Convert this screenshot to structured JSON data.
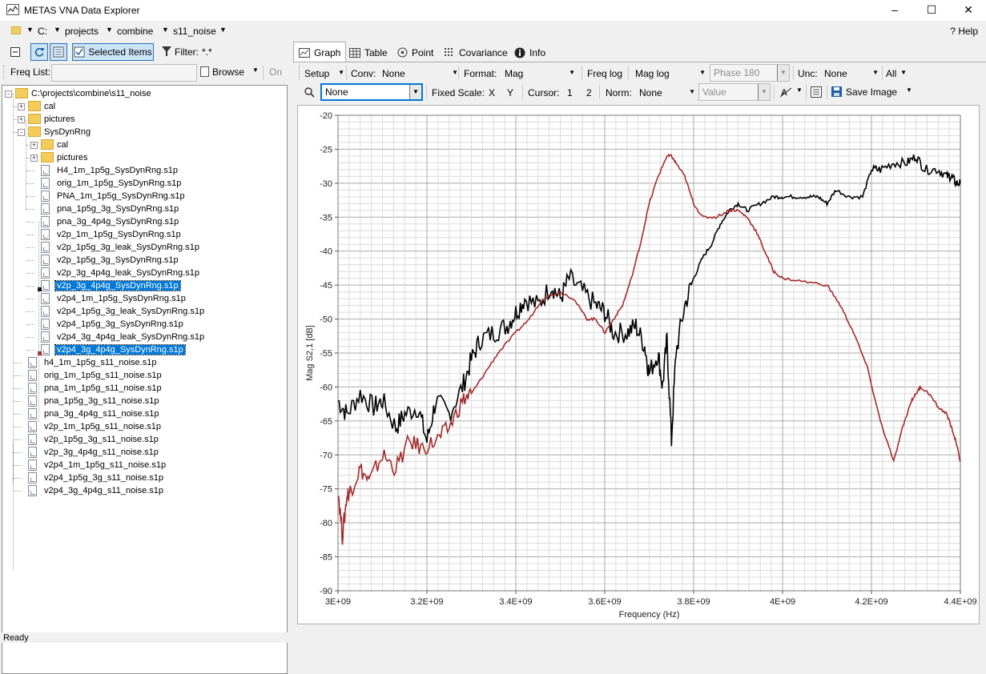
{
  "window": {
    "title": "METAS VNA Data Explorer",
    "minimize": "–",
    "maximize": "☐",
    "close": "✕"
  },
  "address": {
    "drive": "C:",
    "crumbs": [
      "projects",
      "combine",
      "s11_noise"
    ],
    "help": "Help",
    "help_prefix": "?"
  },
  "left_toolbar": {
    "selected_items": "Selected Items",
    "filter_label": "Filter:",
    "filter_value": "*.*"
  },
  "freq_list": {
    "label": "Freq List:",
    "browse": "Browse",
    "on": "On"
  },
  "tree": {
    "root": "C:\\projects\\combine\\s11_noise",
    "items": [
      "cal",
      "pictures",
      "SysDynRng",
      "cal",
      "pictures",
      "H4_1m_1p5g_SysDynRng.s1p",
      "orig_1m_1p5g_SysDynRng.s1p",
      "PNA_1m_1p5g_SysDynRng.s1p",
      "pna_1p5g_3g_SysDynRng.s1p",
      "pna_3g_4p4g_SysDynRng.s1p",
      "v2p_1m_1p5g_SysDynRng.s1p",
      "v2p_1p5g_3g_leak_SysDynRng.s1p",
      "v2p_1p5g_3g_SysDynRng.s1p",
      "v2p_3g_4p4g_leak_SysDynRng.s1p",
      "v2p_3g_4p4g_SysDynRng.s1p",
      "v2p4_1m_1p5g_SysDynRng.s1p",
      "v2p4_1p5g_3g_leak_SysDynRng.s1p",
      "v2p4_1p5g_3g_SysDynRng.s1p",
      "v2p4_3g_4p4g_leak_SysDynRng.s1p",
      "v2p4_3g_4p4g_SysDynRng.s1p",
      "h4_1m_1p5g_s11_noise.s1p",
      "orig_1m_1p5g_s11_noise.s1p",
      "pna_1m_1p5g_s11_noise.s1p",
      "pna_1p5g_3g_s11_noise.s1p",
      "pna_3g_4p4g_s11_noise.s1p",
      "v2p_1m_1p5g_s11_noise.s1p",
      "v2p_1p5g_3g_s11_noise.s1p",
      "v2p_3g_4p4g_s11_noise.s1p",
      "v2p4_1m_1p5g_s11_noise.s1p",
      "v2p4_1p5g_3g_s11_noise.s1p",
      "v2p4_3g_4p4g_s11_noise.s1p"
    ],
    "selected_colors": [
      "#000000",
      "#a52a2a"
    ]
  },
  "tabs": [
    "Graph",
    "Table",
    "Point",
    "Covariance",
    "Info"
  ],
  "options_row1": {
    "setup": "Setup",
    "conv_label": "Conv:",
    "conv_value": "None",
    "format_label": "Format:",
    "format_value": "Mag",
    "freq_log": "Freq log",
    "mag_log": "Mag log",
    "phase": "Phase 180",
    "unc_label": "Unc:",
    "unc_value": "None",
    "all": "All"
  },
  "options_row2": {
    "search_value": "None",
    "fixed_scale": "Fixed Scale:",
    "x": "X",
    "y": "Y",
    "cursor_label": "Cursor:",
    "c1": "1",
    "c2": "2",
    "norm_label": "Norm:",
    "norm_value": "None",
    "value_placeholder": "Value",
    "save_image": "Save Image"
  },
  "status": "Ready",
  "chart_data": {
    "type": "line",
    "xlabel": "Frequency (Hz)",
    "ylabel": "Mag S2,1 [dB]",
    "xlim": [
      3000000000,
      4400000000
    ],
    "ylim": [
      -90,
      -20
    ],
    "x_ticks": [
      "3E+09",
      "3.2E+09",
      "3.4E+09",
      "3.6E+09",
      "3.8E+09",
      "4E+09",
      "4.2E+09",
      "4.4E+09"
    ],
    "y_ticks": [
      "-20",
      "-25",
      "-30",
      "-35",
      "-40",
      "-45",
      "-50",
      "-55",
      "-60",
      "-65",
      "-70",
      "-75",
      "-80",
      "-85",
      "-90"
    ],
    "grid": true,
    "series": [
      {
        "color": "#000000",
        "x": [
          3.0,
          3.02,
          3.05,
          3.08,
          3.1,
          3.13,
          3.15,
          3.18,
          3.2,
          3.22,
          3.25,
          3.28,
          3.3,
          3.32,
          3.35,
          3.38,
          3.4,
          3.42,
          3.45,
          3.48,
          3.5,
          3.52,
          3.55,
          3.58,
          3.6,
          3.62,
          3.65,
          3.67,
          3.69,
          3.7,
          3.72,
          3.73,
          3.74,
          3.75,
          3.76,
          3.78,
          3.8,
          3.82,
          3.84,
          3.86,
          3.88,
          3.9,
          3.92,
          3.95,
          3.98,
          4.0,
          4.03,
          4.06,
          4.08,
          4.1,
          4.12,
          4.15,
          4.18,
          4.2,
          4.22,
          4.25,
          4.28,
          4.3,
          4.32,
          4.35,
          4.37,
          4.38,
          4.39,
          4.4
        ],
        "y": [
          -62,
          -64,
          -61,
          -63,
          -62,
          -66,
          -64,
          -63,
          -68,
          -62,
          -64,
          -60,
          -56,
          -53,
          -52,
          -51,
          -49,
          -47,
          -48,
          -45,
          -47,
          -44,
          -46,
          -48,
          -49,
          -52,
          -52,
          -51,
          -54,
          -58,
          -55,
          -60,
          -53,
          -68,
          -55,
          -48,
          -44,
          -41,
          -39,
          -36,
          -34,
          -33,
          -34,
          -33,
          -32,
          -32,
          -32,
          -32,
          -32,
          -33,
          -31,
          -32,
          -32,
          -28,
          -28,
          -27,
          -27,
          -26,
          -28,
          -28,
          -29,
          -29,
          -30,
          -30
        ]
      },
      {
        "color": "#a52a2a",
        "x": [
          3.0,
          3.01,
          3.02,
          3.03,
          3.05,
          3.07,
          3.1,
          3.13,
          3.16,
          3.19,
          3.22,
          3.25,
          3.28,
          3.3,
          3.33,
          3.36,
          3.4,
          3.43,
          3.46,
          3.5,
          3.53,
          3.56,
          3.58,
          3.6,
          3.62,
          3.64,
          3.66,
          3.68,
          3.7,
          3.72,
          3.74,
          3.75,
          3.76,
          3.78,
          3.8,
          3.82,
          3.85,
          3.88,
          3.9,
          3.92,
          3.94,
          3.96,
          3.98,
          4.0,
          4.05,
          4.1,
          4.13,
          4.16,
          4.19,
          4.22,
          4.25,
          4.27,
          4.29,
          4.3,
          4.31,
          4.33,
          4.35,
          4.37,
          4.38,
          4.39,
          4.4
        ],
        "y": [
          -75,
          -82,
          -76,
          -75,
          -72,
          -74,
          -70,
          -72,
          -68,
          -69,
          -68,
          -66,
          -62,
          -61,
          -58,
          -55,
          -52,
          -50,
          -47,
          -46,
          -47,
          -50,
          -50,
          -52,
          -50,
          -48,
          -44,
          -39,
          -33,
          -29,
          -26,
          -26,
          -27,
          -29,
          -33,
          -35,
          -35,
          -34,
          -34,
          -35,
          -37,
          -40,
          -43,
          -44,
          -44.5,
          -45,
          -48,
          -52,
          -57,
          -65,
          -71,
          -66,
          -62,
          -61,
          -60,
          -61,
          -63,
          -64,
          -66,
          -68,
          -71
        ]
      }
    ]
  }
}
